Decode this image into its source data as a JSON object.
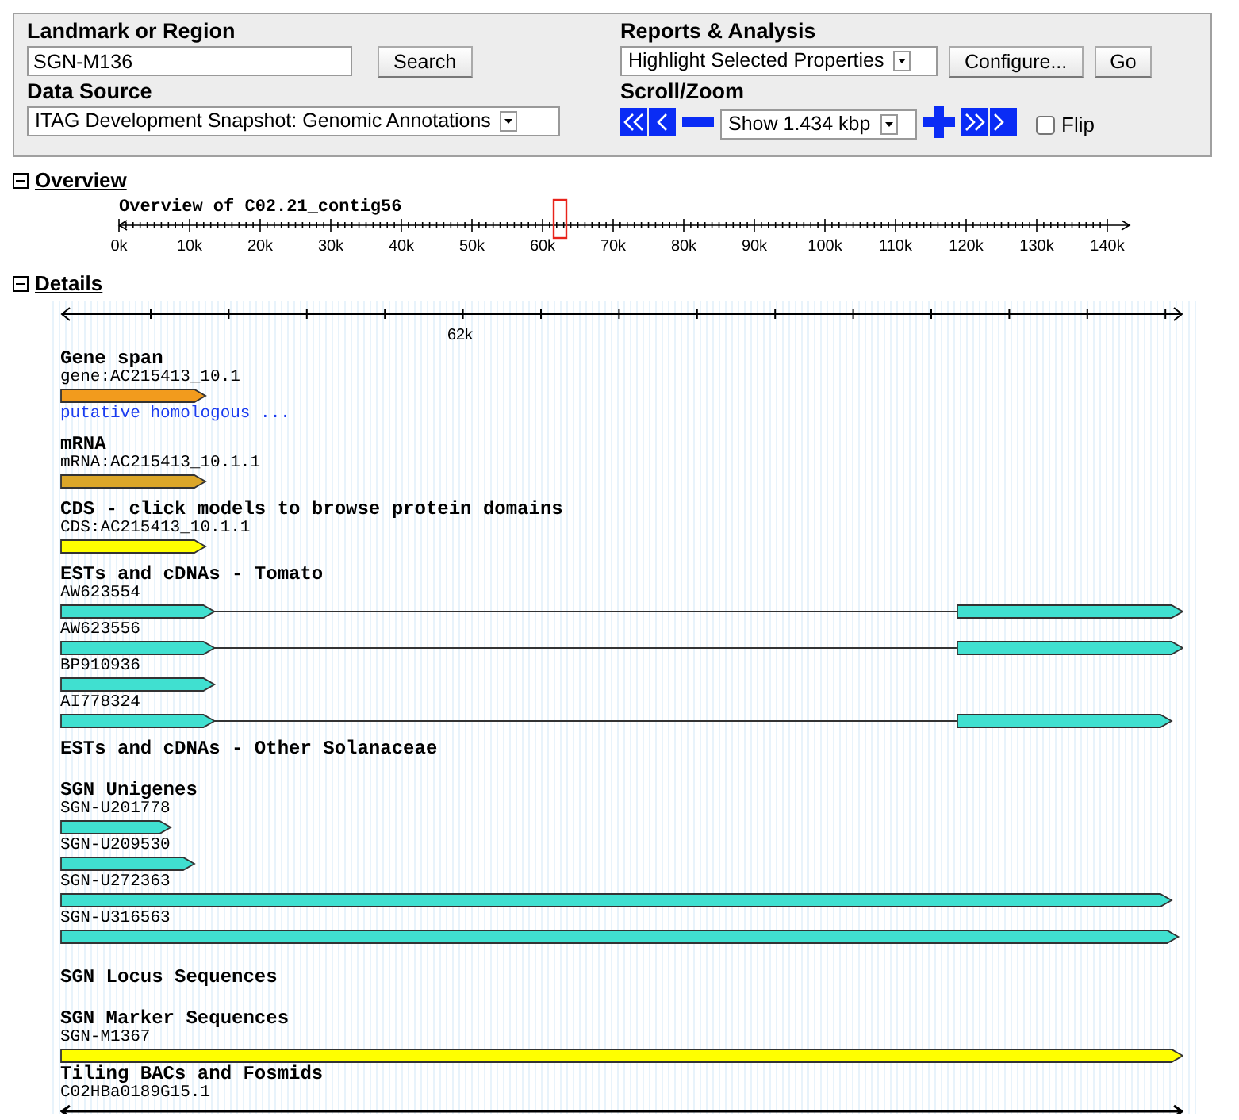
{
  "search": {
    "label": "Landmark or Region",
    "value": "SGN-M136",
    "button": "Search"
  },
  "data_source": {
    "label": "Data Source",
    "value": "ITAG Development Snapshot: Genomic Annotations"
  },
  "reports": {
    "label": "Reports & Analysis",
    "value": "Highlight Selected Properties",
    "buttons": [
      "Configure...",
      "Go"
    ]
  },
  "scroll_zoom": {
    "label": "Scroll/Zoom",
    "value": "Show 1.434 kbp",
    "flip": {
      "label": "Flip",
      "checked": false
    }
  },
  "overview": {
    "title": "Overview",
    "expanded": true,
    "ruler_title": "Overview of C02.21_contig56",
    "ticks": [
      "0k",
      "10k",
      "20k",
      "30k",
      "40k",
      "50k",
      "60k",
      "70k",
      "80k",
      "90k",
      "100k",
      "110k",
      "120k",
      "130k",
      "140k"
    ]
  },
  "details": {
    "title": "Details",
    "expanded": true,
    "ruler_ticks": [
      "62k"
    ],
    "tracks": [
      {
        "title": "Gene span",
        "features": [
          {
            "label": "gene:AC215413_10.1",
            "kind": "arrow",
            "color": "#f29b1d",
            "note": "putative homologous ..."
          }
        ]
      },
      {
        "title": "mRNA",
        "features": [
          {
            "label": "mRNA:AC215413_10.1.1",
            "kind": "arrow",
            "color": "#dba628"
          }
        ]
      },
      {
        "title": "CDS - click models to browse protein domains",
        "features": [
          {
            "label": "CDS:AC215413_10.1.1",
            "kind": "arrow",
            "color": "#ffff00"
          }
        ]
      },
      {
        "title": "ESTs and cDNAs - Tomato",
        "features": [
          {
            "label": "AW623554",
            "kind": "split",
            "color": "#40e0d0"
          },
          {
            "label": "AW623556",
            "kind": "split",
            "color": "#40e0d0"
          },
          {
            "label": "BP910936",
            "kind": "arrow",
            "color": "#40e0d0"
          },
          {
            "label": "AI778324",
            "kind": "split",
            "color": "#40e0d0"
          }
        ]
      },
      {
        "title": "ESTs and cDNAs - Other Solanaceae"
      },
      {
        "title": "SGN Unigenes",
        "features": [
          {
            "label": "SGN-U201778",
            "kind": "arrow",
            "color": "#40e0d0"
          },
          {
            "label": "SGN-U209530",
            "kind": "arrow",
            "color": "#40e0d0"
          },
          {
            "label": "SGN-U272363",
            "kind": "arrow",
            "color": "#40e0d0"
          },
          {
            "label": "SGN-U316563",
            "kind": "arrow",
            "color": "#40e0d0"
          }
        ]
      },
      {
        "title": "SGN Locus Sequences"
      },
      {
        "title": "SGN Marker Sequences",
        "features": [
          {
            "label": "SGN-M1367",
            "kind": "arrow",
            "color": "#ffff00"
          }
        ]
      },
      {
        "title": "Tiling BACs and Fosmids",
        "features": [
          {
            "label": "C02HBa0189G15.1",
            "kind": "line",
            "color": "#000000"
          }
        ]
      }
    ]
  }
}
